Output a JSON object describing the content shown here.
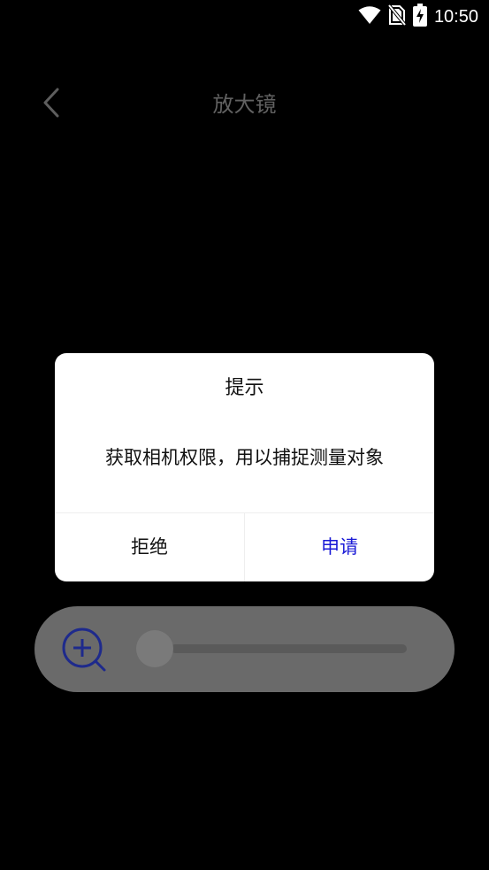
{
  "status_bar": {
    "time": "10:50",
    "icons": [
      "wifi-icon",
      "no-sim-icon",
      "battery-charging-icon"
    ]
  },
  "header": {
    "title": "放大镜",
    "back_icon": "chevron-left-icon"
  },
  "zoom_control": {
    "icon": "zoom-in-icon",
    "slider_value_fraction": 0.0
  },
  "dialog": {
    "title": "提示",
    "message": "获取相机权限，用以捕捉测量对象",
    "reject_label": "拒绝",
    "apply_label": "申请"
  },
  "colors": {
    "background": "#000000",
    "dialog_background": "#ffffff",
    "accent": "#1a1ad6",
    "zoom_icon": "#1e2a8c",
    "dimmed_panel": "#6a6a6a"
  }
}
